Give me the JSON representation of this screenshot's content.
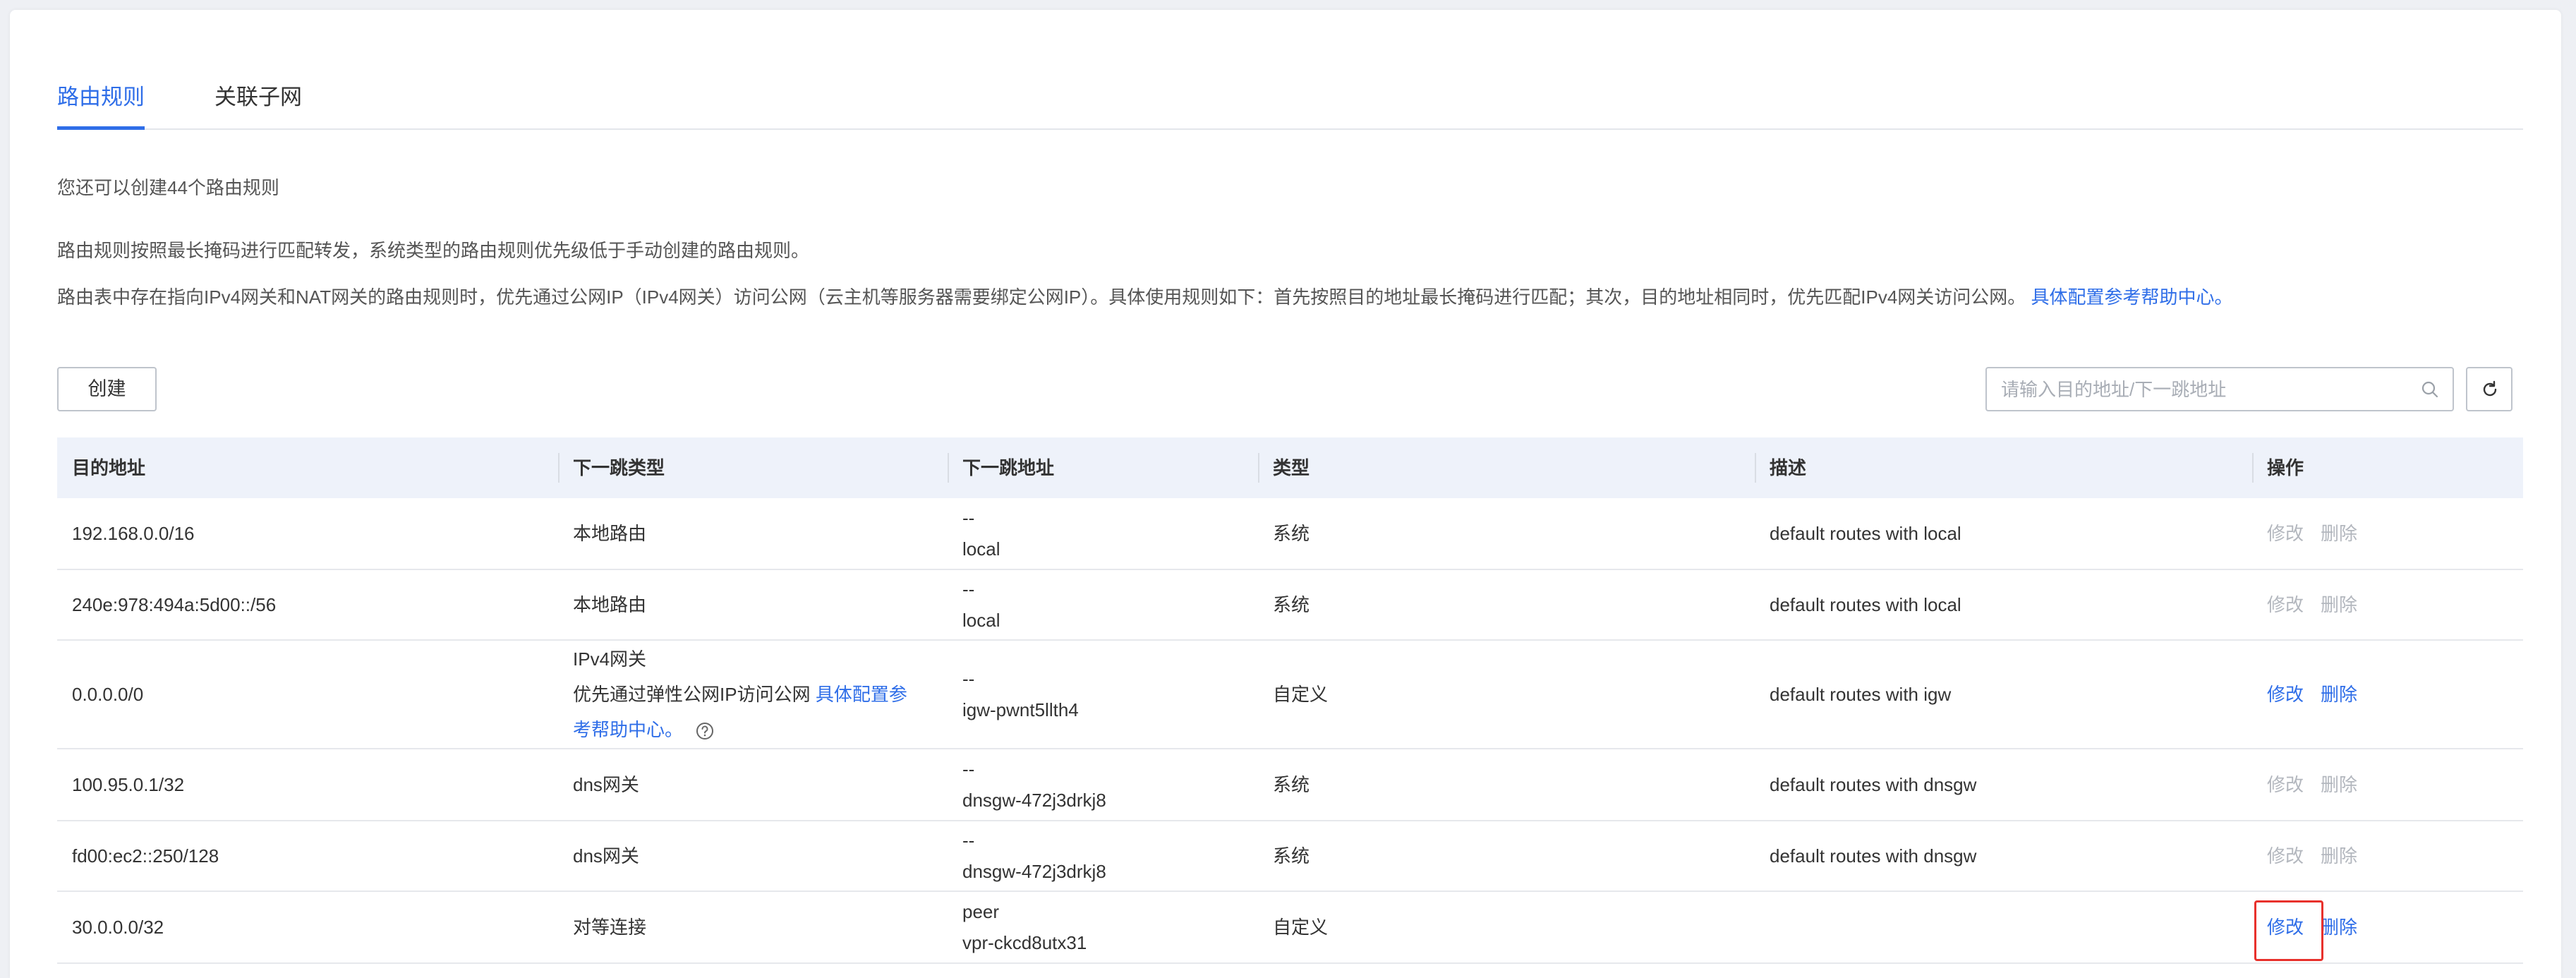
{
  "tabs": [
    {
      "label": "路由规则",
      "active": true
    },
    {
      "label": "关联子网",
      "active": false
    }
  ],
  "info": {
    "quota": "您还可以创建44个路由规则",
    "rule1": "路由规则按照最长掩码进行匹配转发，系统类型的路由规则优先级低于手动创建的路由规则。",
    "rule2": "路由表中存在指向IPv4网关和NAT网关的路由规则时，优先通过公网IP（IPv4网关）访问公网（云主机等服务器需要绑定公网IP）。具体使用规则如下：首先按照目的地址最长掩码进行匹配；其次，目的地址相同时，优先匹配IPv4网关访问公网。",
    "rule2_link": "具体配置参考帮助中心。"
  },
  "toolbar": {
    "create_label": "创建",
    "search_placeholder": "请输入目的地址/下一跳地址"
  },
  "table": {
    "headers": [
      "目的地址",
      "下一跳类型",
      "下一跳地址",
      "类型",
      "描述",
      "操作"
    ],
    "rows": [
      {
        "dest": "192.168.0.0/16",
        "hop_type": "本地路由",
        "hop_addr_top": "--",
        "hop_addr_bottom": "local",
        "type": "系统",
        "desc": "default routes with local",
        "edit": "修改",
        "delete": "删除",
        "enabled": false
      },
      {
        "dest": "240e:978:494a:5d00::/56",
        "hop_type": "本地路由",
        "hop_addr_top": "--",
        "hop_addr_bottom": "local",
        "type": "系统",
        "desc": "default routes with local",
        "edit": "修改",
        "delete": "删除",
        "enabled": false
      },
      {
        "dest": "0.0.0.0/0",
        "hop_type": "IPv4网关",
        "hop_type_note": "优先通过弹性公网IP访问公网",
        "hop_type_link_1": "具体配置参",
        "hop_type_link_2": "考帮助中心。",
        "hop_addr_top": "--",
        "hop_addr_bottom": "igw-pwnt5llth4",
        "type": "自定义",
        "desc": "default routes with igw",
        "edit": "修改",
        "delete": "删除",
        "enabled": true
      },
      {
        "dest": "100.95.0.1/32",
        "hop_type": "dns网关",
        "hop_addr_top": "--",
        "hop_addr_bottom": "dnsgw-472j3drkj8",
        "type": "系统",
        "desc": "default routes with dnsgw",
        "edit": "修改",
        "delete": "删除",
        "enabled": false
      },
      {
        "dest": "fd00:ec2::250/128",
        "hop_type": "dns网关",
        "hop_addr_top": "--",
        "hop_addr_bottom": "dnsgw-472j3drkj8",
        "type": "系统",
        "desc": "default routes with dnsgw",
        "edit": "修改",
        "delete": "删除",
        "enabled": false
      },
      {
        "dest": "30.0.0.0/32",
        "hop_type": "对等连接",
        "hop_addr_top": "peer",
        "hop_addr_bottom": "vpr-ckcd8utx31",
        "type": "自定义",
        "desc": "",
        "edit": "修改",
        "delete": "删除",
        "enabled": true
      }
    ]
  },
  "colors": {
    "accent": "#2f6ee8",
    "disabled": "#b3b7be",
    "highlight": "#e8312c",
    "header_bg": "#eef2fa"
  }
}
